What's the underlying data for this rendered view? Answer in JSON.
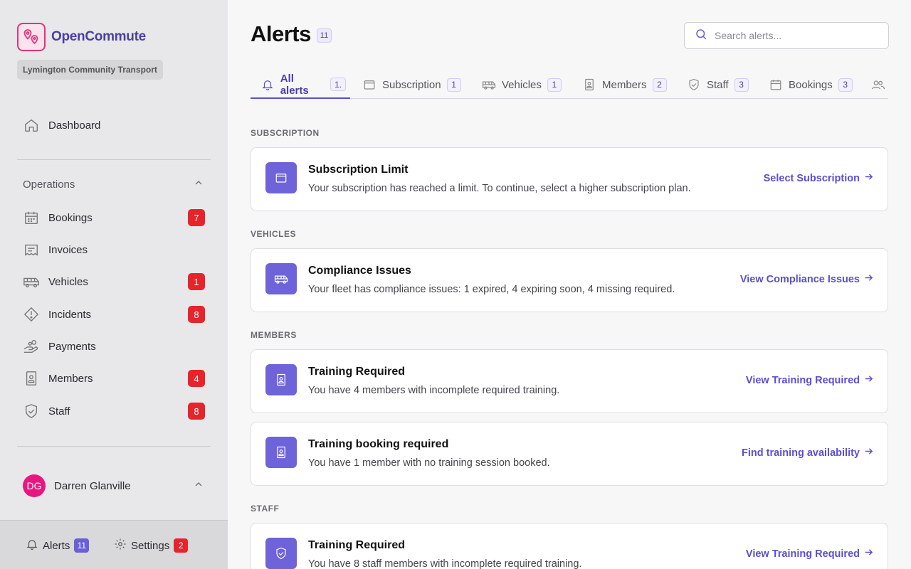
{
  "app": {
    "name": "OpenCommute",
    "organization": "Lymington Community Transport"
  },
  "sidebar": {
    "dashboard": {
      "label": "Dashboard",
      "icon": "home-icon"
    },
    "operations_label": "Operations",
    "items": [
      {
        "label": "Bookings",
        "icon": "calendar-icon",
        "badge": "7"
      },
      {
        "label": "Invoices",
        "icon": "receipt-icon",
        "badge": ""
      },
      {
        "label": "Vehicles",
        "icon": "bus-icon",
        "badge": "1"
      },
      {
        "label": "Incidents",
        "icon": "warning-icon",
        "badge": "8"
      },
      {
        "label": "Payments",
        "icon": "hand-coins-icon",
        "badge": ""
      },
      {
        "label": "Members",
        "icon": "id-badge-icon",
        "badge": "4"
      },
      {
        "label": "Staff",
        "icon": "shield-icon",
        "badge": "8"
      }
    ],
    "user": {
      "initials": "DG",
      "name": "Darren Glanville"
    },
    "footer": {
      "alerts_label": "Alerts",
      "alerts_count": "11",
      "settings_label": "Settings",
      "settings_count": "2"
    }
  },
  "main": {
    "title": "Alerts",
    "title_count": "11",
    "search_placeholder": "Search alerts...",
    "tabs": [
      {
        "label": "All alerts",
        "count": "1.",
        "icon": "bell-icon",
        "active": true
      },
      {
        "label": "Subscription",
        "count": "1",
        "icon": "wallet-icon"
      },
      {
        "label": "Vehicles",
        "count": "1",
        "icon": "bus-icon"
      },
      {
        "label": "Members",
        "count": "2",
        "icon": "id-badge-icon"
      },
      {
        "label": "Staff",
        "count": "3",
        "icon": "shield-icon"
      },
      {
        "label": "Bookings",
        "count": "3",
        "icon": "calendar-icon"
      },
      {
        "label": "",
        "count": "",
        "icon": "users-icon"
      }
    ],
    "sections": [
      {
        "label": "SUBSCRIPTION",
        "cards": [
          {
            "icon": "wallet-icon",
            "title": "Subscription Limit",
            "description": "Your subscription has reached a limit. To continue, select a higher subscription plan.",
            "action": "Select Subscription"
          }
        ]
      },
      {
        "label": "VEHICLES",
        "cards": [
          {
            "icon": "bus-icon",
            "title": "Compliance Issues",
            "description": "Your fleet has compliance issues: 1 expired, 4 expiring soon, 4 missing required.",
            "action": "View Compliance Issues"
          }
        ]
      },
      {
        "label": "MEMBERS",
        "cards": [
          {
            "icon": "id-badge-icon",
            "title": "Training Required",
            "description": "You have 4 members with incomplete required training.",
            "action": "View Training Required"
          },
          {
            "icon": "id-badge-icon",
            "title": "Training booking required",
            "description": "You have 1 member with no training session booked.",
            "action": "Find training availability"
          }
        ]
      },
      {
        "label": "STAFF",
        "cards": [
          {
            "icon": "shield-icon",
            "title": "Training Required",
            "description": "You have 8 staff members with incomplete required training.",
            "action": "View Training Required"
          }
        ]
      }
    ]
  },
  "colors": {
    "accent": "#5a4fd0",
    "badge_red": "#e5252b",
    "brand_pink": "#e2337f"
  }
}
